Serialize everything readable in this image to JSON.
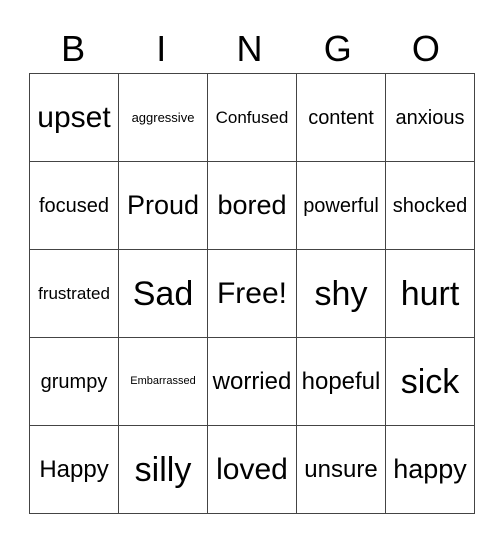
{
  "header": [
    "B",
    "I",
    "N",
    "G",
    "O"
  ],
  "rows": [
    [
      "upset",
      "aggressive",
      "Confused",
      "content",
      "anxious"
    ],
    [
      "focused",
      "Proud",
      "bored",
      "powerful",
      "shocked"
    ],
    [
      "frustrated",
      "Sad",
      "Free!",
      "shy",
      "hurt"
    ],
    [
      "grumpy",
      "Embarrassed",
      "worried",
      "hopeful",
      "sick"
    ],
    [
      "Happy",
      "silly",
      "loved",
      "unsure",
      "happy"
    ]
  ]
}
